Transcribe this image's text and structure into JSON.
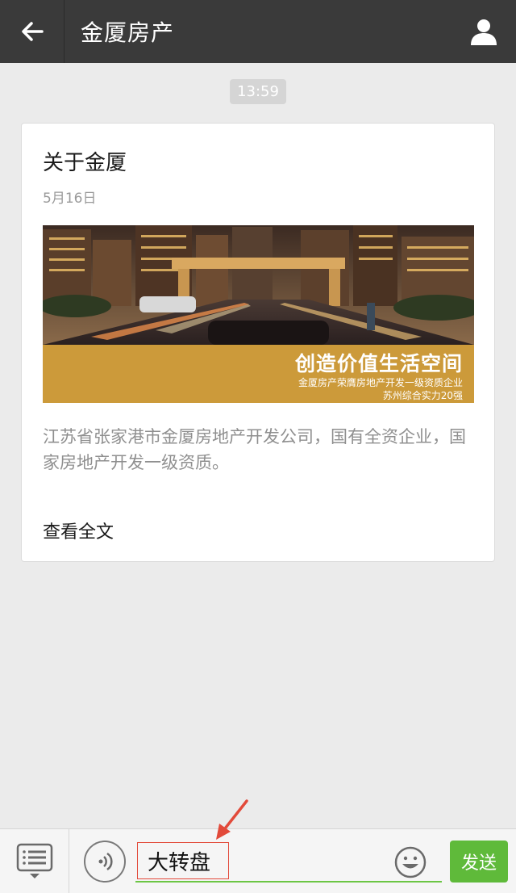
{
  "header": {
    "title": "金厦房产",
    "back_icon": "arrow-left-icon",
    "profile_icon": "person-icon"
  },
  "chat": {
    "timestamp": "13:59"
  },
  "article": {
    "title": "关于金厦",
    "date": "5月16日",
    "banner": {
      "slogan": "创造价值生活空间",
      "line1": "金厦房产荣膺房地产开发一级资质企业",
      "line2": "苏州综合实力20强"
    },
    "description": "江苏省张家港市金厦房地产开发公司，国有全资企业，国家房地产开发一级资质。",
    "read_more": "查看全文"
  },
  "input_bar": {
    "menu_icon": "menu-list-icon",
    "voice_icon": "voice-icon",
    "input_value": "大转盘",
    "emoji_icon": "smiley-icon",
    "send_label": "发送"
  },
  "colors": {
    "header_bg": "#3a3a3a",
    "page_bg": "#ebebeb",
    "send_green": "#5fba3a",
    "banner_gold": "#cc9a3a",
    "annotation_red": "#e24a3a"
  }
}
